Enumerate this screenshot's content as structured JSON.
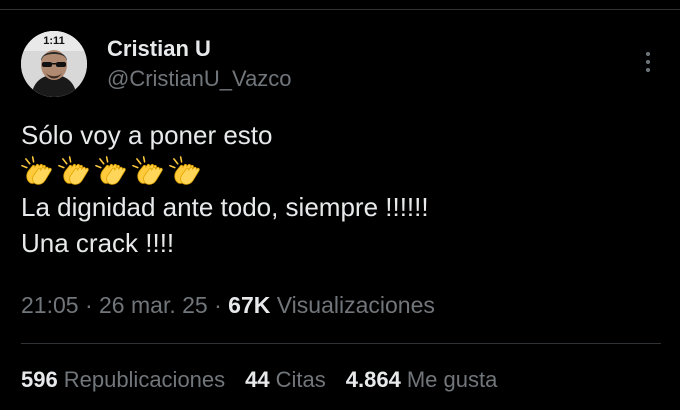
{
  "author": {
    "display_name": "Cristian U",
    "handle": "@CristianU_Vazco",
    "avatar_badge": "1:11"
  },
  "tweet": {
    "lines": [
      "Sólo voy a poner esto",
      "La dignidad ante todo, siempre !!!!!!",
      "Una crack !!!!"
    ],
    "emoji_row": [
      "clapping-hands-icon",
      "clapping-hands-icon",
      "clapping-hands-icon",
      "clapping-hands-icon",
      "clapping-hands-icon"
    ]
  },
  "meta": {
    "time": "21:05",
    "separator": " · ",
    "date": "26 mar. 25",
    "views_count": "67K",
    "views_label": "Visualizaciones"
  },
  "stats": {
    "reposts_count": "596",
    "reposts_label": "Republicaciones",
    "quotes_count": "44",
    "quotes_label": "Citas",
    "likes_count": "4.864",
    "likes_label": "Me gusta"
  },
  "colors": {
    "background": "#000000",
    "primary_text": "#e7e9ea",
    "secondary_text": "#71767b",
    "divider": "#2f3336",
    "emoji_yellow": "#ffcb3d"
  }
}
